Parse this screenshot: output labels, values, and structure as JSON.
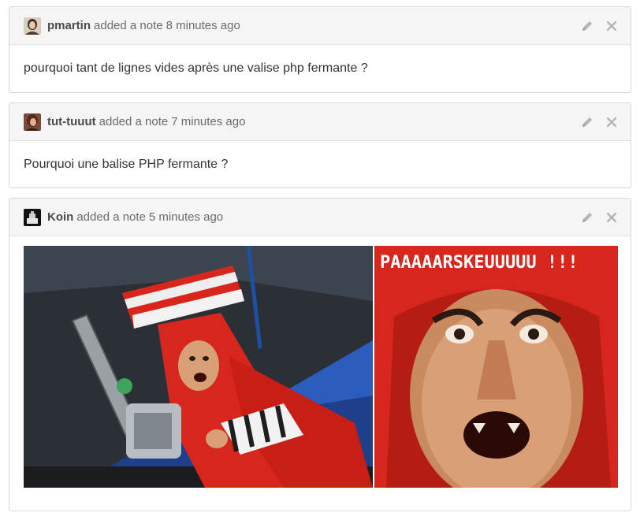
{
  "notes": [
    {
      "author": "pmartin",
      "action": "added a note",
      "time": "8 minutes ago",
      "body": "pourquoi tant de lignes vides après une valise php fermante ?"
    },
    {
      "author": "tut-tuuut",
      "action": "added a note",
      "time": "7 minutes ago",
      "body": "Pourquoi une balise PHP fermante ?"
    },
    {
      "author": "Koin",
      "action": "added a note",
      "time": "5 minutes ago",
      "image_caption": "PAAAAARSKEUUUUU !!!"
    }
  ],
  "icons": {
    "edit": "pencil-icon",
    "delete": "close-icon"
  },
  "colors": {
    "header_bg": "#f5f5f5",
    "border": "#d8d8d8",
    "icon": "#b5b5b5",
    "meme_red": "#d8261c"
  }
}
